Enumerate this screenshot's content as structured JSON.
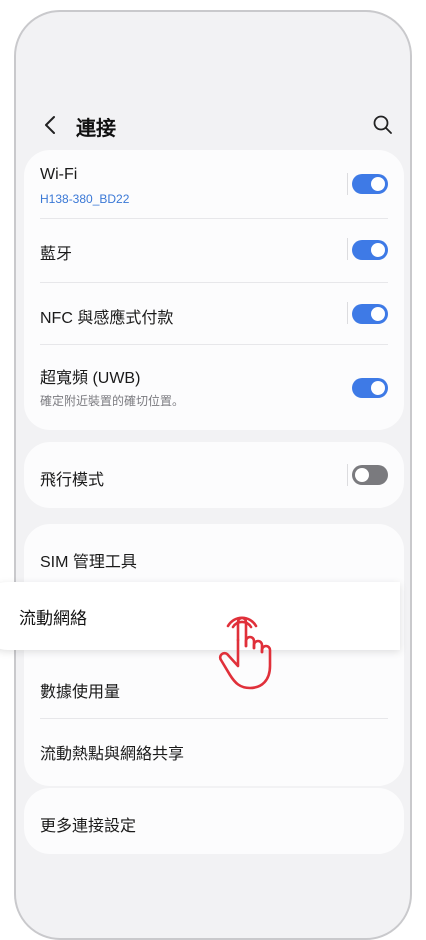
{
  "header": {
    "title": "連接",
    "back_icon": "chevron-left-icon",
    "search_icon": "search-icon"
  },
  "connections": {
    "wifi": {
      "label": "Wi-Fi",
      "network": "H138-380_BD22",
      "on": true
    },
    "bluetooth": {
      "label": "藍牙",
      "on": true
    },
    "nfc": {
      "label": "NFC 與感應式付款",
      "on": true
    },
    "uwb": {
      "label": "超寬頻 (UWB)",
      "description": "確定附近裝置的確切位置。",
      "on": true
    }
  },
  "airplane": {
    "label": "飛行模式",
    "on": false
  },
  "network": {
    "sim_manager": "SIM 管理工具",
    "mobile_networks": "流動網絡",
    "data_usage": "數據使用量",
    "hotspot": "流動熱點與網絡共享"
  },
  "more": {
    "label": "更多連接設定"
  },
  "colors": {
    "accent": "#3e7ae6",
    "link": "#3a78d6",
    "toggle_off": "#7a7a7e",
    "tap_indicator": "#e0303a"
  }
}
